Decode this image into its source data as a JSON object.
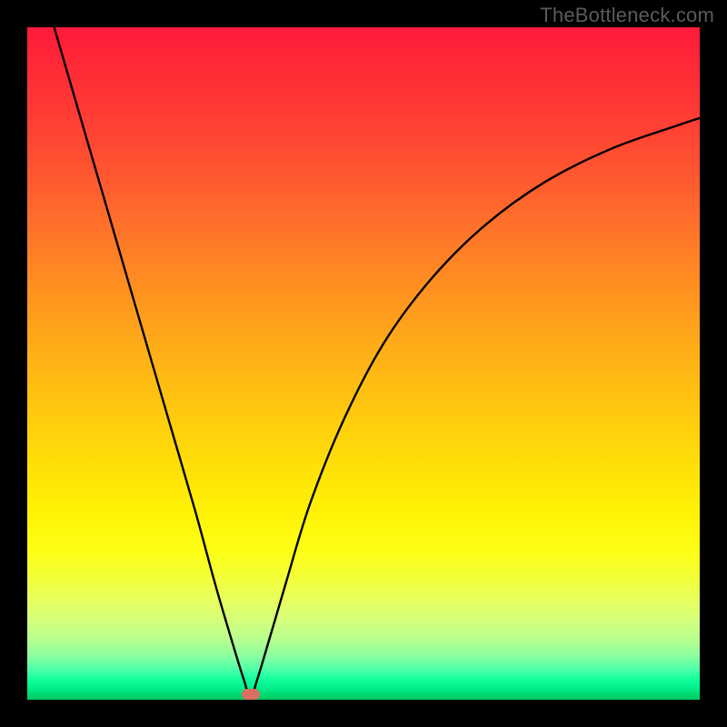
{
  "watermark": "TheBottleneck.com",
  "chart_data": {
    "type": "line",
    "title": "",
    "xlabel": "",
    "ylabel": "",
    "xlim": [
      0,
      1
    ],
    "ylim": [
      0,
      1
    ],
    "notch_x": 0.332,
    "marker": {
      "x": 0.332,
      "y": 0.008
    },
    "series": [
      {
        "name": "curve",
        "x": [
          0.04,
          0.075,
          0.11,
          0.145,
          0.18,
          0.215,
          0.25,
          0.28,
          0.305,
          0.322,
          0.332,
          0.342,
          0.36,
          0.385,
          0.42,
          0.47,
          0.53,
          0.6,
          0.68,
          0.77,
          0.87,
          0.97,
          1.0
        ],
        "y": [
          1.0,
          0.88,
          0.76,
          0.64,
          0.52,
          0.4,
          0.28,
          0.17,
          0.085,
          0.03,
          0.003,
          0.03,
          0.09,
          0.175,
          0.29,
          0.415,
          0.53,
          0.625,
          0.705,
          0.77,
          0.82,
          0.855,
          0.865
        ]
      }
    ]
  }
}
